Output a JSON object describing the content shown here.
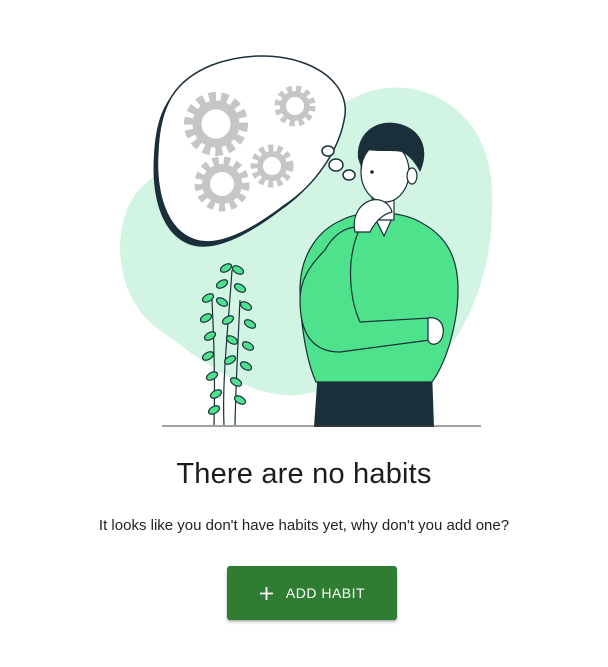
{
  "empty_state": {
    "illustration": "thinking-person-with-gears",
    "title": "There are no habits",
    "message": "It looks like you don't have habits yet, why don't you add one?",
    "button_icon": "plus-icon",
    "button_label": "ADD HABIT"
  },
  "colors": {
    "accent": "#2e7d32",
    "blob": "#d2f5e3",
    "shirt": "#4ee28d",
    "dark": "#1a2f3a",
    "gear": "#c6c6c6"
  }
}
